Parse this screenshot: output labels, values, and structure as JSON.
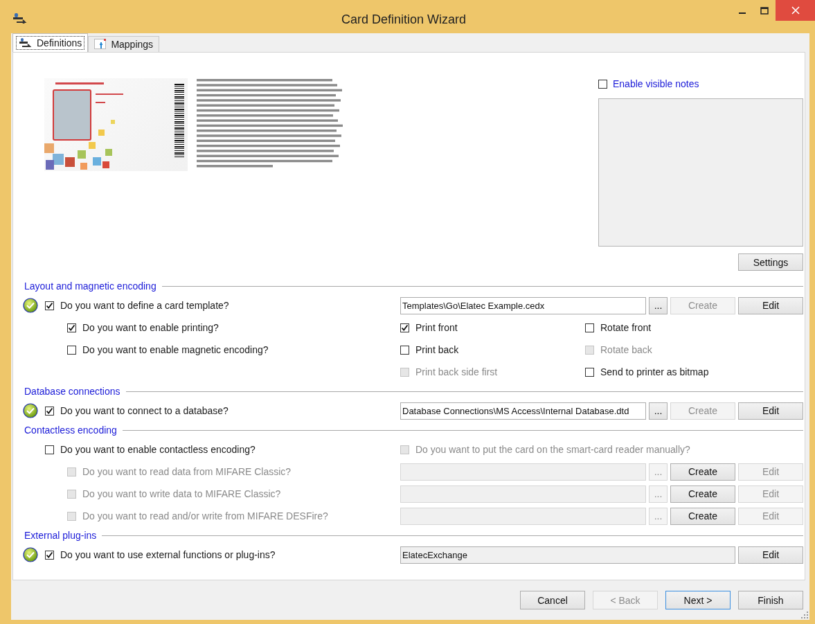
{
  "window": {
    "title": "Card Definition Wizard"
  },
  "tabs": [
    {
      "label": "Definitions",
      "selected": true
    },
    {
      "label": "Mappings",
      "selected": false
    }
  ],
  "notes": {
    "label": "Enable visible notes",
    "checked": false,
    "settings_button": "Settings"
  },
  "sections": [
    {
      "title": "Layout and magnetic encoding",
      "items": [
        {
          "done": true,
          "label": "Do you want to define a card template?",
          "checked": true,
          "disabled": false,
          "right": {
            "kind": "path",
            "field": {
              "value": "Templates\\Go\\Elatec Example.cedx",
              "disabled": false,
              "readonly": false
            },
            "buttons": [
              {
                "label": "...",
                "disabled": false
              },
              {
                "label": "Create",
                "disabled": true
              },
              {
                "label": "Edit",
                "disabled": false
              }
            ]
          },
          "children": [
            {
              "done": false,
              "label": "Do you want to enable printing?",
              "checked": true,
              "disabled": false,
              "right": {
                "kind": "options",
                "options": [
                  {
                    "label": "Print front",
                    "checked": true,
                    "disabled": false
                  },
                  {
                    "label": "Rotate front",
                    "checked": false,
                    "disabled": false
                  }
                ]
              }
            },
            {
              "done": false,
              "label": "Do you want to enable magnetic encoding?",
              "checked": false,
              "disabled": false,
              "right": {
                "kind": "options",
                "options": [
                  {
                    "label": "Print back",
                    "checked": false,
                    "disabled": false
                  },
                  {
                    "label": "Rotate back",
                    "checked": false,
                    "disabled": true
                  }
                ]
              }
            },
            {
              "right": {
                "kind": "options",
                "options": [
                  {
                    "label": "Print back side first",
                    "checked": false,
                    "disabled": true
                  },
                  {
                    "label": "Send to printer as bitmap",
                    "checked": false,
                    "disabled": false
                  }
                ]
              }
            }
          ]
        }
      ]
    },
    {
      "title": "Database connections",
      "items": [
        {
          "done": true,
          "label": "Do you want to connect to a database?",
          "checked": true,
          "disabled": false,
          "right": {
            "kind": "path",
            "field": {
              "value": "Database Connections\\MS Access\\Internal Database.dtd",
              "disabled": false,
              "readonly": false
            },
            "buttons": [
              {
                "label": "...",
                "disabled": false
              },
              {
                "label": "Create",
                "disabled": true
              },
              {
                "label": "Edit",
                "disabled": false
              }
            ]
          }
        }
      ]
    },
    {
      "title": "Contactless encoding",
      "items": [
        {
          "done": false,
          "label": "Do you want to enable contactless encoding?",
          "checked": false,
          "disabled": false,
          "right": {
            "kind": "options",
            "options": [
              {
                "label": "Do you want to put the card on the smart-card reader manually?",
                "checked": false,
                "disabled": true
              }
            ]
          },
          "children": [
            {
              "done": false,
              "label": "Do you want to read data from MIFARE Classic?",
              "checked": false,
              "disabled": true,
              "right": {
                "kind": "path",
                "field": {
                  "disabled": true
                },
                "buttons": [
                  {
                    "label": "...",
                    "disabled": true
                  },
                  {
                    "label": "Create",
                    "disabled": false
                  },
                  {
                    "label": "Edit",
                    "disabled": true
                  }
                ]
              }
            },
            {
              "done": false,
              "label": "Do you want to write data to MIFARE Classic?",
              "checked": false,
              "disabled": true,
              "right": {
                "kind": "path",
                "field": {
                  "disabled": true
                },
                "buttons": [
                  {
                    "label": "...",
                    "disabled": true
                  },
                  {
                    "label": "Create",
                    "disabled": false
                  },
                  {
                    "label": "Edit",
                    "disabled": true
                  }
                ]
              }
            },
            {
              "done": false,
              "label": "Do you want to read and/or write from MIFARE DESFire?",
              "checked": false,
              "disabled": true,
              "right": {
                "kind": "path",
                "field": {
                  "disabled": true
                },
                "buttons": [
                  {
                    "label": "...",
                    "disabled": true
                  },
                  {
                    "label": "Create",
                    "disabled": false
                  },
                  {
                    "label": "Edit",
                    "disabled": true
                  }
                ]
              }
            }
          ]
        }
      ]
    },
    {
      "title": "External plug-ins",
      "items": [
        {
          "done": true,
          "label": "Do you want to use external functions or plug-ins?",
          "checked": true,
          "disabled": false,
          "right": {
            "kind": "path",
            "field": {
              "value": "ElatecExchange",
              "disabled": false,
              "readonly": true
            },
            "buttons": [
              {
                "label": "Edit",
                "disabled": false
              }
            ]
          }
        }
      ]
    }
  ],
  "buttons": [
    {
      "label": "Cancel",
      "disabled": false,
      "default": false
    },
    {
      "label": "< Back",
      "disabled": true,
      "default": false
    },
    {
      "label": "Next >",
      "disabled": false,
      "default": true
    },
    {
      "label": "Finish",
      "disabled": false,
      "default": false
    }
  ]
}
